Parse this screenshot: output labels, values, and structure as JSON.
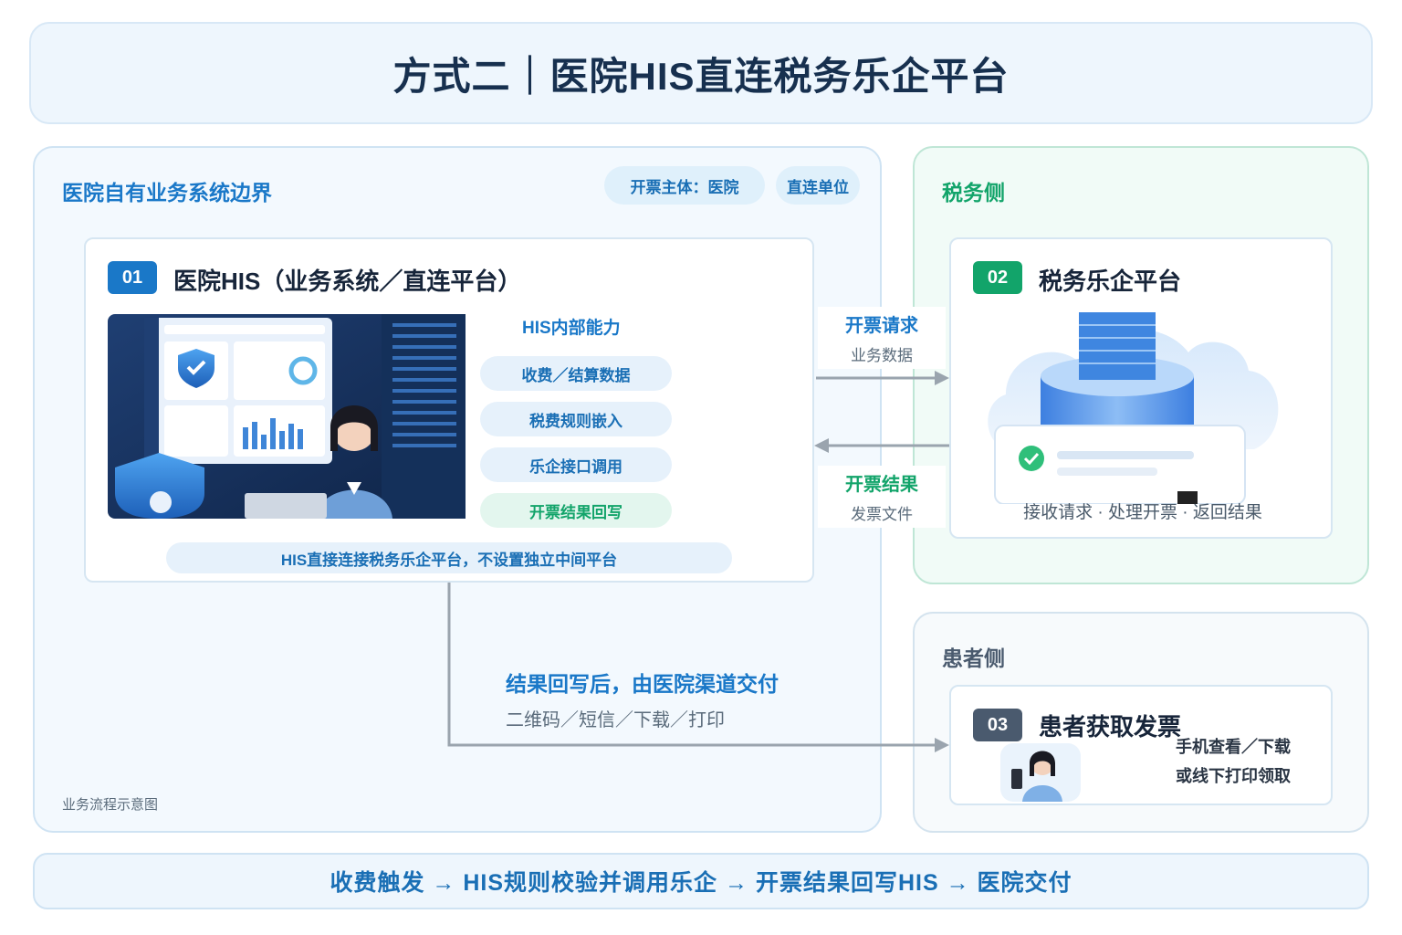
{
  "title": "方式二｜医院HIS直连税务乐企平台",
  "hospital_region": {
    "title": "医院自有业务系统边界",
    "pill_subject": "开票主体：医院",
    "pill_direct": "直连单位",
    "footnote": "业务流程示意图"
  },
  "his_card": {
    "badge": "01",
    "title": "医院HIS（业务系统／直连平台）",
    "capabilities_title": "HIS内部能力",
    "capabilities": [
      "收费／结算数据",
      "税费规则嵌入",
      "乐企接口调用",
      "开票结果回写"
    ],
    "note": "HIS直接连接税务乐企平台，不设置独立中间平台"
  },
  "tax_region": {
    "title": "税务侧",
    "badge": "02",
    "card_title": "税务乐企平台",
    "caption": "接收请求 · 处理开票 · 返回结果"
  },
  "patient_region": {
    "title": "患者侧",
    "badge": "03",
    "card_title": "患者获取发票",
    "line1": "手机查看／下载",
    "line2": "或线下打印领取"
  },
  "flows": {
    "request_title": "开票请求",
    "request_sub": "业务数据",
    "result_title": "开票结果",
    "result_sub": "发票文件",
    "delivery_title": "结果回写后，由医院渠道交付",
    "delivery_sub": "二维码／短信／下载／打印"
  },
  "summary": "收费触发 → HIS规则校验并调用乐企 → 开票结果回写HIS → 医院交付",
  "colors": {
    "blue": "#1a78c8",
    "green": "#12a46a",
    "dark_badge": "#4a5a6e",
    "arrow": "#9aa4ae"
  }
}
